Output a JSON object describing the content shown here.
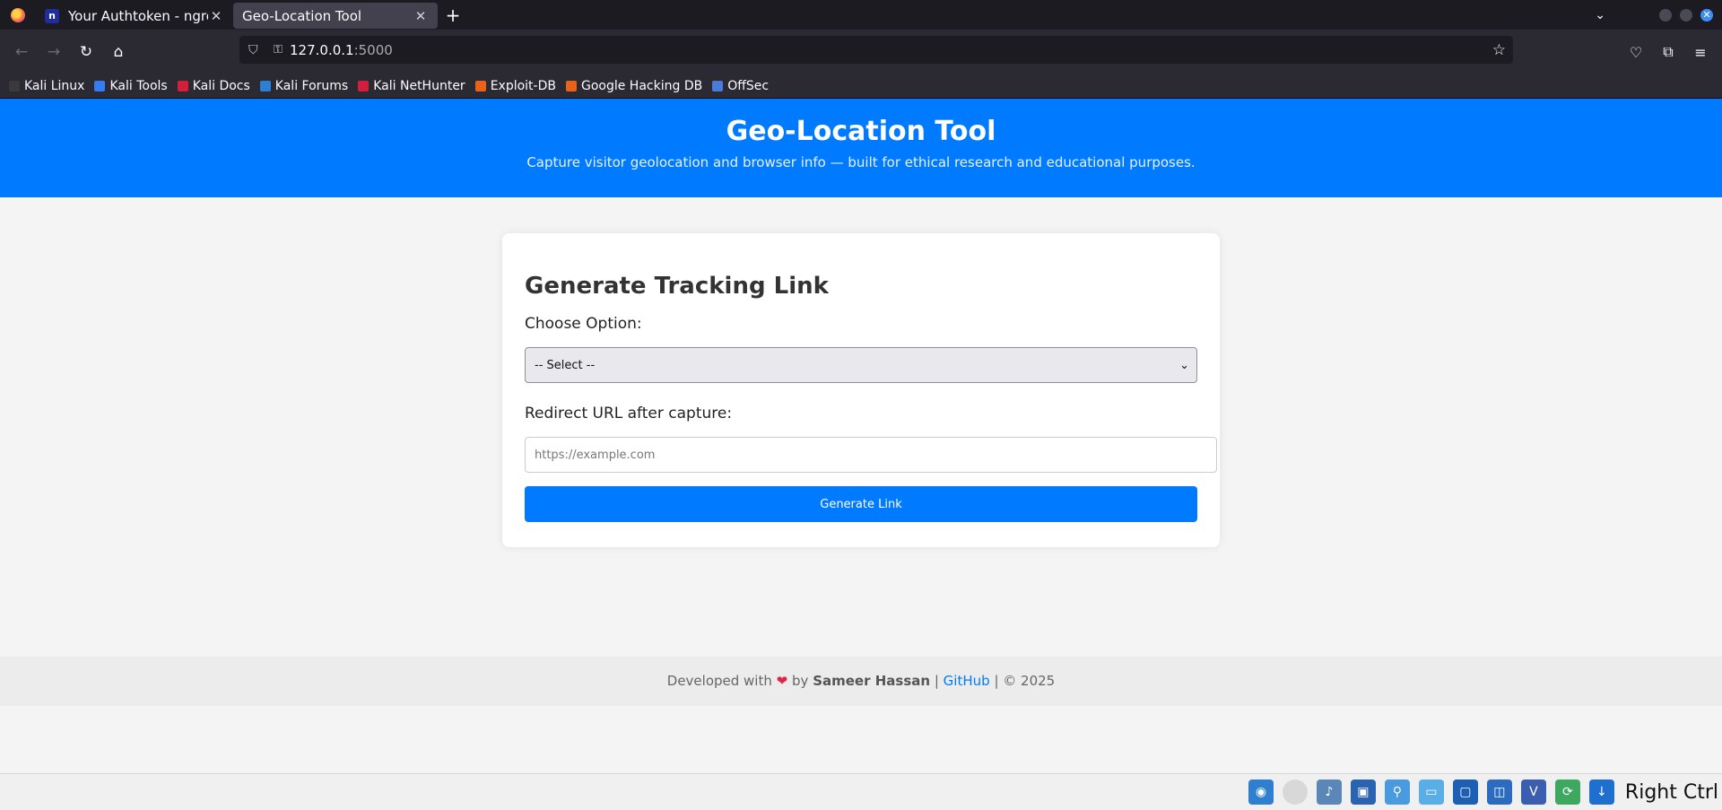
{
  "browser": {
    "tabs": [
      {
        "title": "Your Authtoken - ngrok",
        "favicon": "n",
        "active": false
      },
      {
        "title": "Geo-Location Tool",
        "active": true
      }
    ],
    "new_tab_label": "+",
    "url_host": "127.0.0.1",
    "url_port": ":5000",
    "bookmarks": [
      {
        "label": "Kali Linux",
        "color": "#3a3a3a"
      },
      {
        "label": "Kali Tools",
        "color": "#367bf0"
      },
      {
        "label": "Kali Docs",
        "color": "#d21f3c"
      },
      {
        "label": "Kali Forums",
        "color": "#2d7fd3"
      },
      {
        "label": "Kali NetHunter",
        "color": "#d21f3c"
      },
      {
        "label": "Exploit-DB",
        "color": "#e8621a"
      },
      {
        "label": "Google Hacking DB",
        "color": "#e8621a"
      },
      {
        "label": "OffSec",
        "color": "#4a7bd6"
      }
    ]
  },
  "page": {
    "header": {
      "title": "Geo-Location Tool",
      "subtitle": "Capture visitor geolocation and browser info — built for ethical research and educational purposes."
    },
    "card": {
      "heading": "Generate Tracking Link",
      "option_label": "Choose Option:",
      "option_selected": "-- Select --",
      "redirect_label": "Redirect URL after capture:",
      "redirect_placeholder": "https://example.com",
      "redirect_value": "",
      "button_label": "Generate Link"
    },
    "footer": {
      "prefix": "Developed with",
      "by": "by",
      "author": "Sameer Hassan",
      "sep1": "|",
      "link": "GitHub",
      "sep2": "|",
      "copyright": "© 2025"
    }
  },
  "vbox": {
    "host_key": "Right Ctrl"
  },
  "colors": {
    "accent": "#007bff",
    "header_bg": "#007bff",
    "page_bg": "#f4f4f4",
    "heart": "#e0244a"
  }
}
